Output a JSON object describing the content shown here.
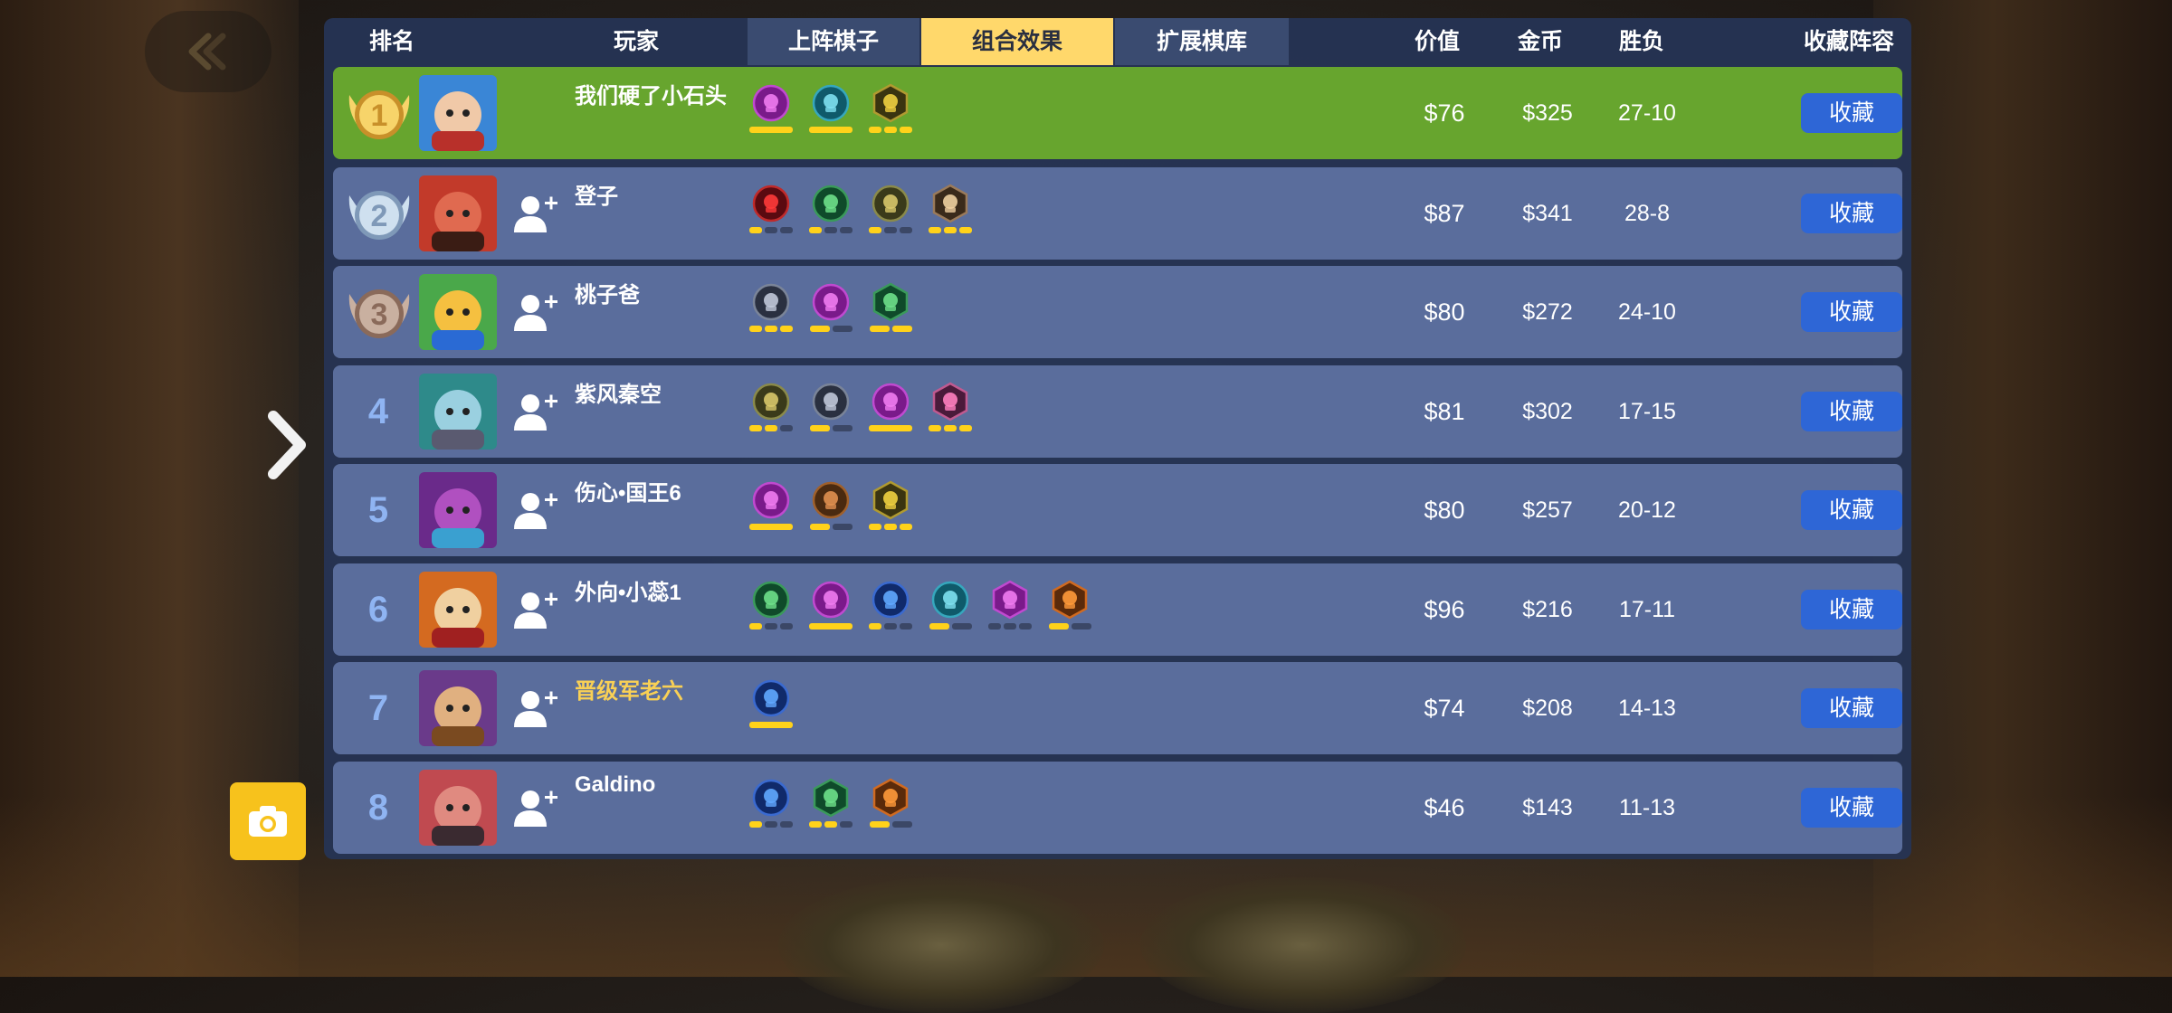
{
  "header": {
    "rank": "排名",
    "player": "玩家",
    "tabs": [
      "上阵棋子",
      "组合效果",
      "扩展棋库"
    ],
    "active_tab": "组合效果",
    "value": "价值",
    "gold": "金币",
    "win_loss": "胜负",
    "fav_lineup": "收藏阵容"
  },
  "colors": {
    "panel": "#26344f",
    "row": "#5a6d9c",
    "row_highlight": "#67a52e",
    "active_tab": "#ffd86b",
    "button": "#2e66d6",
    "bar_on": "#ffd21a",
    "camera": "#f7c21c"
  },
  "rows": [
    {
      "rank": "1",
      "medal": "gold",
      "name": "我们硬了小石头",
      "self": true,
      "value": "$76",
      "gold": "$325",
      "wl": "27-10",
      "button": "收藏",
      "synergies": [
        {
          "icon": "purple-skull-icon",
          "bars": 1,
          "on": 1
        },
        {
          "icon": "teal-dragon-icon",
          "bars": 1,
          "on": 1
        },
        {
          "icon": "trident-icon",
          "bars": 3,
          "on": 3
        }
      ]
    },
    {
      "rank": "2",
      "medal": "silver",
      "name": "登子",
      "value": "$87",
      "gold": "$341",
      "wl": "28-8",
      "button": "收藏",
      "synergies": [
        {
          "icon": "red-arch-icon",
          "bars": 3,
          "on": 1
        },
        {
          "icon": "green-paw-icon",
          "bars": 3,
          "on": 1
        },
        {
          "icon": "olive-beast-icon",
          "bars": 3,
          "on": 1
        },
        {
          "icon": "axe-hexagon-icon",
          "bars": 3,
          "on": 3
        }
      ]
    },
    {
      "rank": "3",
      "medal": "bronze",
      "name": "桃子爸",
      "value": "$80",
      "gold": "$272",
      "wl": "24-10",
      "button": "收藏",
      "synergies": [
        {
          "icon": "grey-figures-icon",
          "bars": 3,
          "on": 3
        },
        {
          "icon": "purple-fish-icon",
          "bars": 2,
          "on": 1
        },
        {
          "icon": "green-crossbow-hexagon-icon",
          "bars": 2,
          "on": 2
        }
      ]
    },
    {
      "rank": "4",
      "name": "紫风秦空",
      "value": "$81",
      "gold": "$302",
      "wl": "17-15",
      "button": "收藏",
      "synergies": [
        {
          "icon": "olive-beast-icon",
          "bars": 3,
          "on": 2
        },
        {
          "icon": "grey-helmet-icon",
          "bars": 2,
          "on": 1
        },
        {
          "icon": "purple-skull-icon",
          "bars": 1,
          "on": 1
        },
        {
          "icon": "pink-knight-hexagon-icon",
          "bars": 3,
          "on": 3
        }
      ]
    },
    {
      "rank": "5",
      "name": "伤心•国王6",
      "value": "$80",
      "gold": "$257",
      "wl": "20-12",
      "button": "收藏",
      "synergies": [
        {
          "icon": "purple-skull-icon",
          "bars": 1,
          "on": 1
        },
        {
          "icon": "brown-spider-icon",
          "bars": 2,
          "on": 1
        },
        {
          "icon": "trident-icon",
          "bars": 3,
          "on": 3
        }
      ]
    },
    {
      "rank": "6",
      "name": "外向•小蕊1",
      "value": "$96",
      "gold": "$216",
      "wl": "17-11",
      "button": "收藏",
      "synergies": [
        {
          "icon": "green-paw-icon",
          "bars": 3,
          "on": 1
        },
        {
          "icon": "purple-skull-icon",
          "bars": 1,
          "on": 1
        },
        {
          "icon": "blue-feather-icon",
          "bars": 3,
          "on": 1
        },
        {
          "icon": "teal-spirit-icon",
          "bars": 2,
          "on": 1
        },
        {
          "icon": "purple-scroll-hexagon-icon",
          "bars": 3,
          "on": 0
        },
        {
          "icon": "orange-leaf-hexagon-icon",
          "bars": 2,
          "on": 1
        }
      ]
    },
    {
      "rank": "7",
      "name": "晋级军老六",
      "name_gold": true,
      "value": "$74",
      "gold": "$208",
      "wl": "14-13",
      "button": "收藏",
      "synergies": [
        {
          "icon": "blue-crest-icon",
          "bars": 1,
          "on": 1
        }
      ]
    },
    {
      "rank": "8",
      "name": "Galdino",
      "value": "$46",
      "gold": "$143",
      "wl": "11-13",
      "button": "收藏",
      "synergies": [
        {
          "icon": "blue-feather-icon",
          "bars": 3,
          "on": 1
        },
        {
          "icon": "green-crossbow-hexagon-icon",
          "bars": 3,
          "on": 2
        },
        {
          "icon": "orange-leaf-hexagon-icon",
          "bars": 2,
          "on": 1
        }
      ]
    }
  ]
}
